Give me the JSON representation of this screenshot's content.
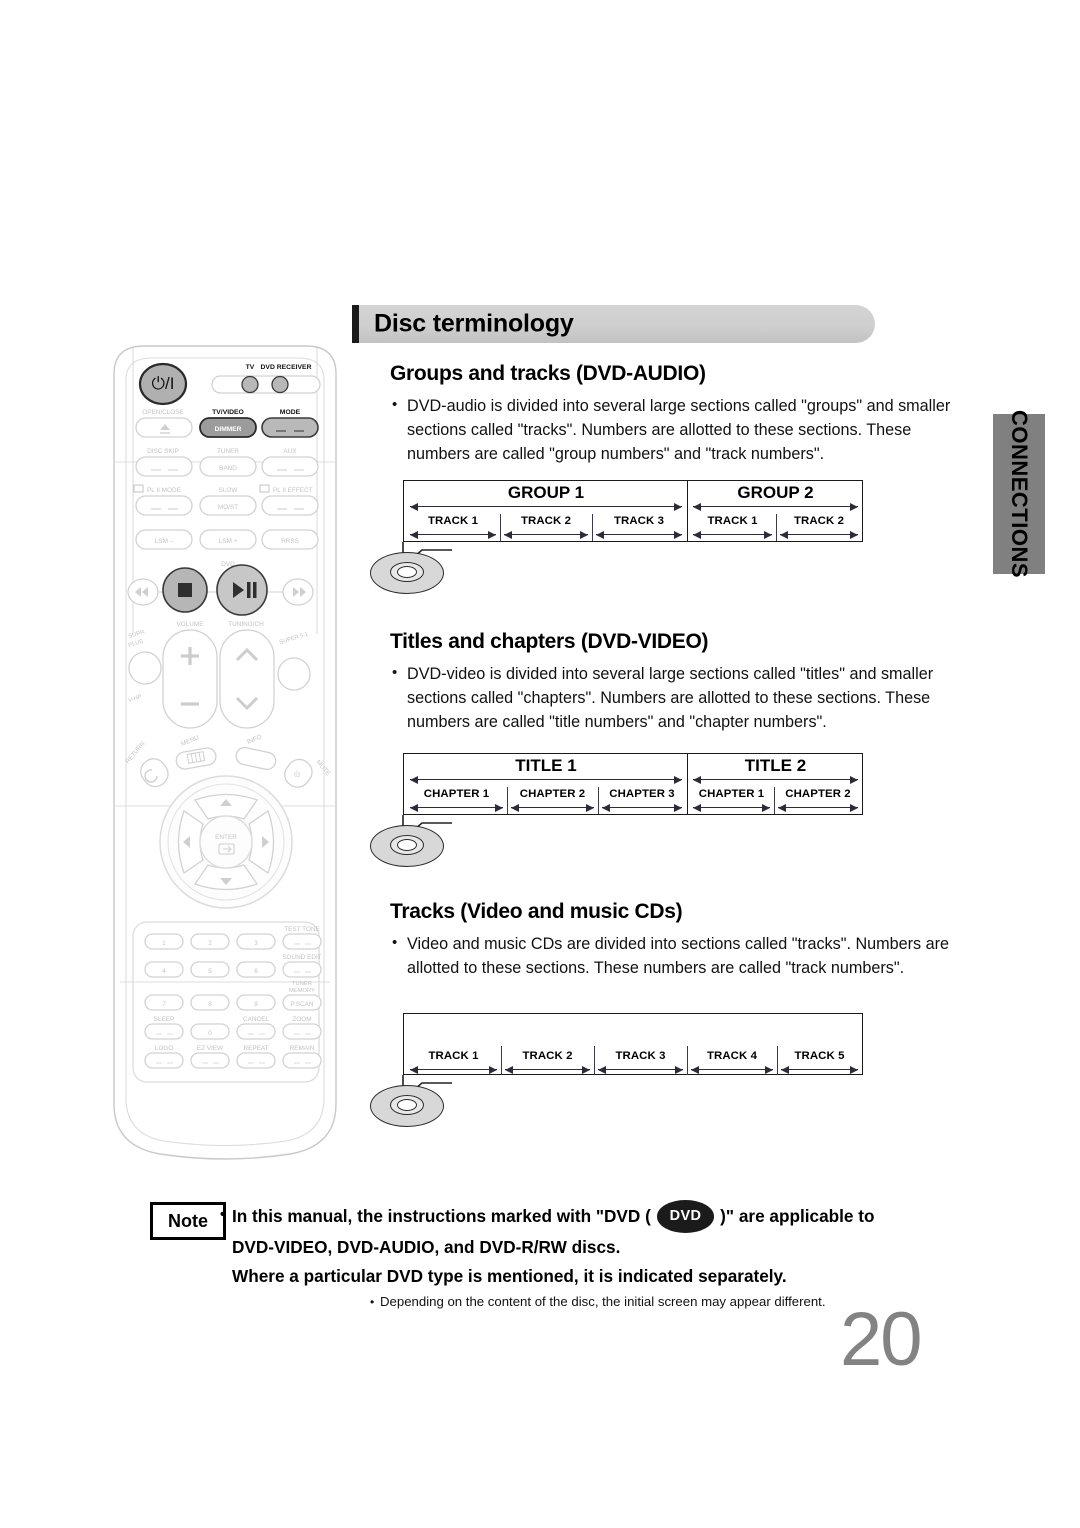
{
  "page": {
    "number": "20",
    "side_tab": "CONNECTIONS",
    "title": "Disc terminology"
  },
  "sections": [
    {
      "id": "groups-and-tracks",
      "heading": "Groups and tracks (DVD-AUDIO)",
      "body": "DVD-audio is divided into several large sections called \"groups\" and smaller sections called \"tracks\". Numbers are allotted to these sections. These numbers are called \"group numbers\" and \"track numbers\"."
    },
    {
      "id": "titles-and-chapters",
      "heading": "Titles and chapters (DVD-VIDEO)",
      "body": "DVD-video is divided into several large sections called \"titles\" and smaller sections called \"chapters\". Numbers are allotted to these sections. These numbers are called \"title numbers\" and \"chapter numbers\"."
    },
    {
      "id": "tracks-cd",
      "heading": "Tracks (Video and music CDs)",
      "body": "Video and music CDs are divided into sections called \"tracks\". Numbers are allotted to these sections. These numbers are called \"track numbers\"."
    }
  ],
  "diagrams": {
    "dvd_audio": {
      "majors": [
        "GROUP 1",
        "GROUP 2"
      ],
      "minors": [
        "TRACK 1",
        "TRACK 2",
        "TRACK 3",
        "TRACK 1",
        "TRACK 2"
      ]
    },
    "dvd_video": {
      "majors": [
        "TITLE 1",
        "TITLE 2"
      ],
      "minors": [
        "CHAPTER 1",
        "CHAPTER 2",
        "CHAPTER 3",
        "CHAPTER 1",
        "CHAPTER 2"
      ]
    },
    "cd": {
      "majors": [],
      "minors": [
        "TRACK 1",
        "TRACK 2",
        "TRACK 3",
        "TRACK 4",
        "TRACK 5"
      ]
    }
  },
  "note": {
    "badge": "Note",
    "line1_a": "In this manual, the instructions marked with \"DVD ( ",
    "pill": "DVD",
    "line1_b": " )\" are applicable to",
    "line2": "DVD-VIDEO, DVD-AUDIO, and DVD-R/RW discs.",
    "line3": "Where a particular DVD type is mentioned, it is indicated separately.",
    "sub": "Depending on the content of the disc, the initial screen may appear different."
  },
  "remote": {
    "power_label": "⏻/I",
    "indicators": [
      "TV",
      "DVD RECEIVER"
    ],
    "row_open_close": [
      "OPEN/CLOSE",
      "TV/VIDEO",
      "MODE"
    ],
    "btn_dimmer": "DIMMER",
    "row_disc_skip": [
      "DISC SKIP",
      "TUNER",
      "AUX"
    ],
    "btn_band": "BAND",
    "row_plii": [
      "PL II MODE",
      "SLOW",
      "PL II EFFECT"
    ],
    "btn_most": "MO/ST",
    "row_lsm": [
      "LSM –",
      "LSM +",
      "RRSS"
    ],
    "transport_label": "DVD",
    "volume_label": "VOLUME",
    "tuning_label": "TUNING/CH",
    "surr_plus": "SURR. PLUS",
    "v_hp": "V-HP",
    "super51": "SUPER 5.1",
    "menu": "MENU",
    "info": "INFO",
    "return": "RETURN",
    "mute": "MUTE",
    "enter": "ENTER",
    "keypad": [
      "1",
      "2",
      "3",
      "4",
      "5",
      "6",
      "7",
      "8",
      "9",
      "0"
    ],
    "test_tone": "TEST TONE",
    "sound_edit": "SOUND EDIT",
    "tuner_memory": "TUNER MEMORY",
    "pscan": "P.SCAN",
    "sleep": "SLEEP",
    "cancel": "CANCEL",
    "zoom": "ZOOM",
    "logo": "LOGO",
    "ez_view": "EZ VIEW",
    "repeat": "REPEAT",
    "remain": "REMAIN"
  },
  "colors": {
    "title_bar": "#cfcfcf",
    "accent": "#1a1a1a",
    "side_tab": "#808080",
    "page_number": "#838383",
    "arrow": "#2b2b3a"
  }
}
